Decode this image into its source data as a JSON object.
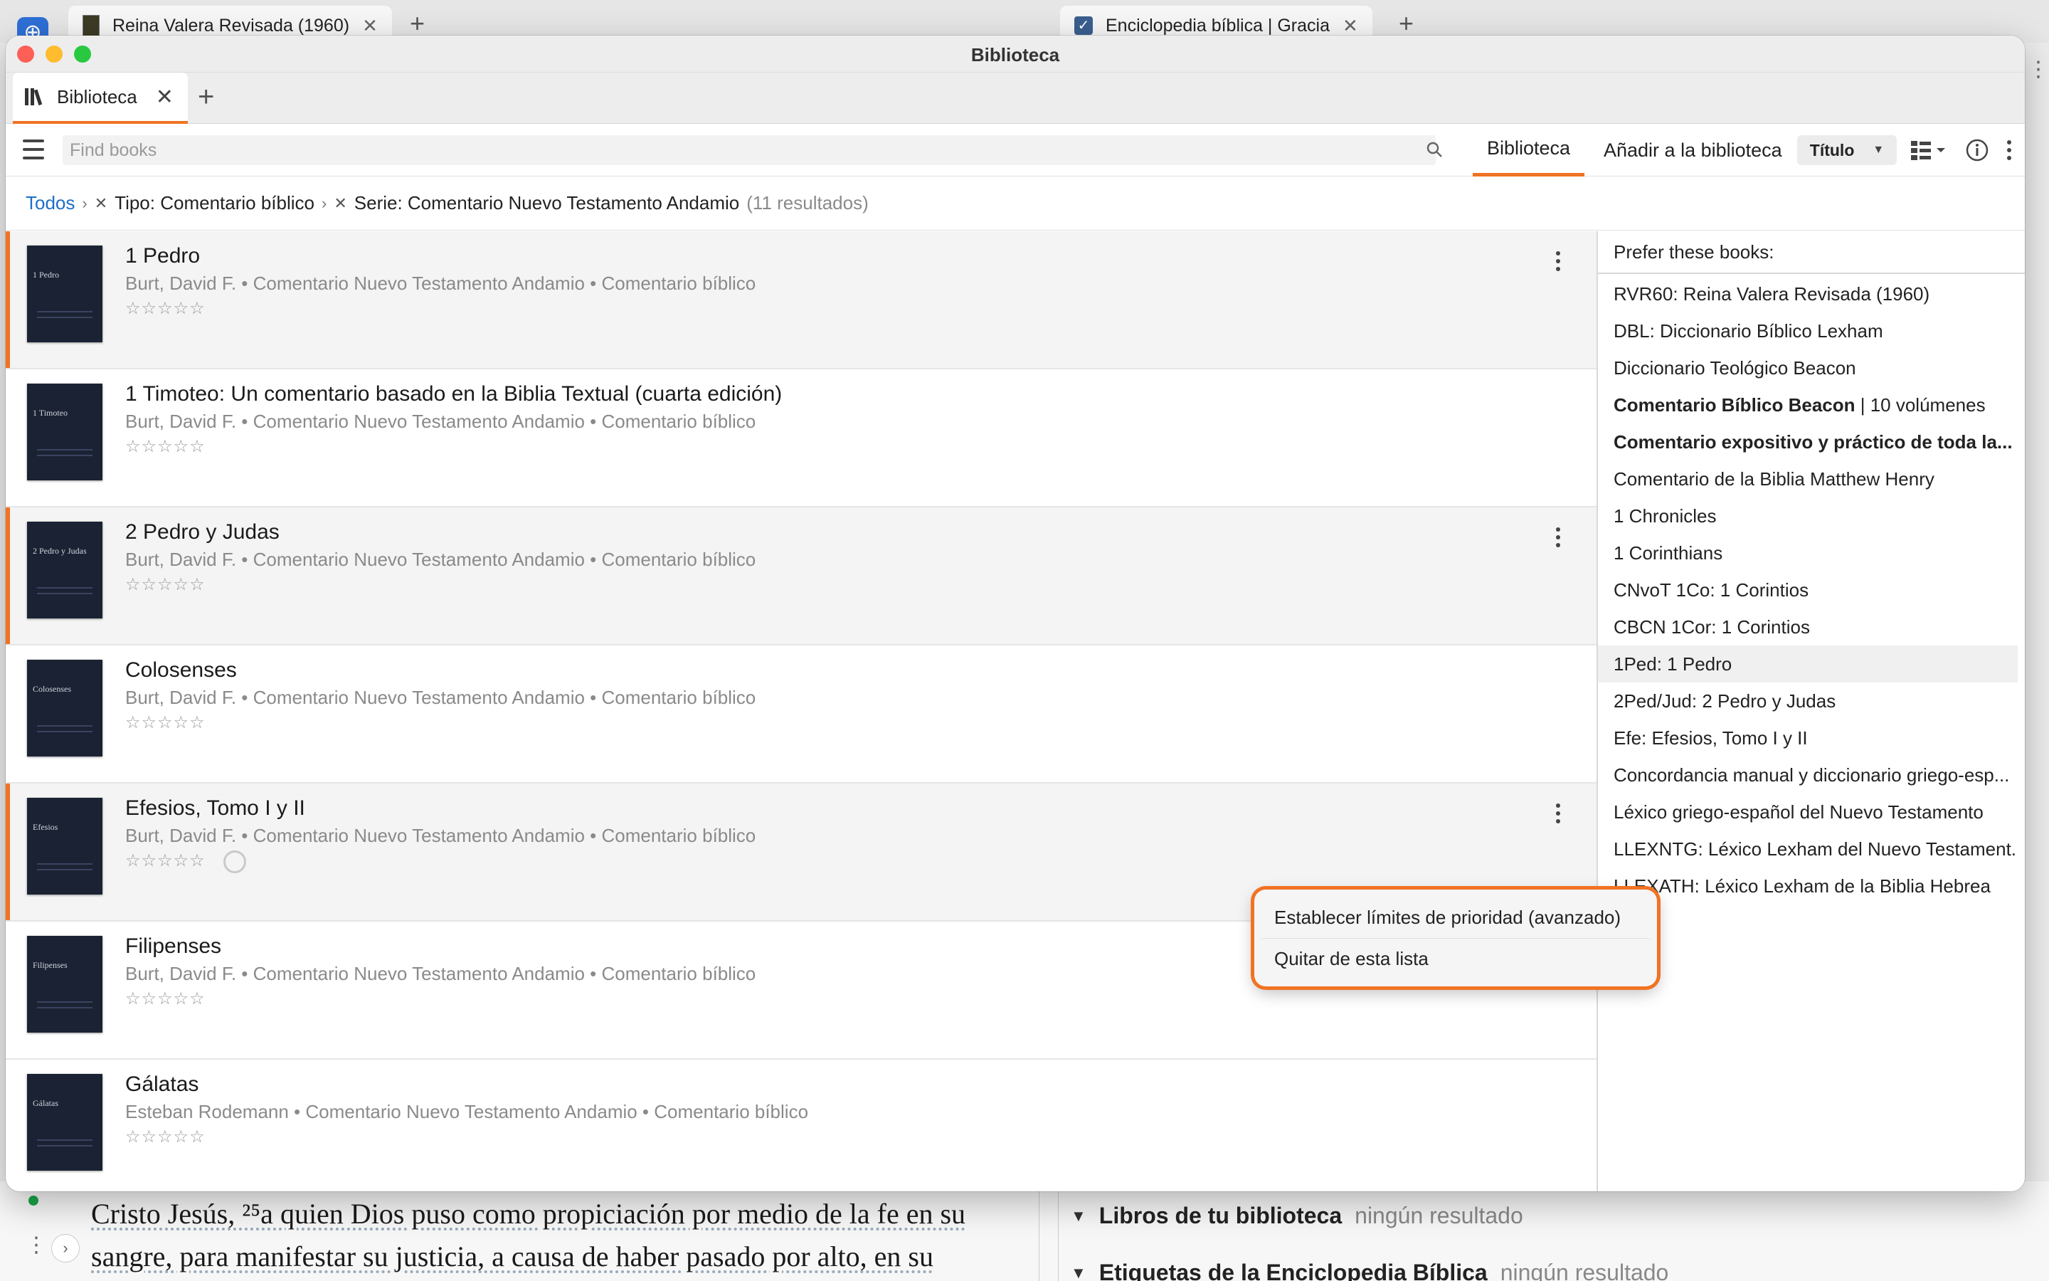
{
  "background": {
    "tabs": [
      {
        "label": "Reina Valera Revisada (1960)"
      },
      {
        "label": "Enciclopedia bíblica | Gracia"
      }
    ],
    "text_line_1": "Cristo Jesús, ²⁵a quien Dios puso como propiciación por medio de la fe en su",
    "text_line_2": "sangre, para manifestar su justicia, a causa de haber pasado por alto, en su",
    "right_section_1": {
      "title": "Libros de tu biblioteca",
      "status": "ningún resultado"
    },
    "right_section_2": {
      "title": "Etiquetas de la Enciclopedia Bíblica",
      "status": "ningún resultado"
    }
  },
  "window": {
    "title": "Biblioteca",
    "tab": {
      "label": "Biblioteca"
    },
    "search_placeholder": "Find books",
    "toolbar": {
      "tab_library": "Biblioteca",
      "tab_add": "Añadir a la biblioteca",
      "sort_label": "Título"
    },
    "breadcrumbs": {
      "root": "Todos",
      "filter_type": "Tipo: Comentario bíblico",
      "filter_series": "Serie: Comentario Nuevo Testamento Andamio",
      "count": "(11 resultados)"
    }
  },
  "books": [
    {
      "title": "1 Pedro",
      "meta": "Burt, David F. • Comentario Nuevo Testamento Andamio • Comentario bíblico",
      "stars": "☆☆☆☆☆",
      "cover_title": "1 Pedro"
    },
    {
      "title": "1 Timoteo: Un comentario basado en la Biblia Textual (cuarta edición)",
      "meta": "Burt, David F. • Comentario Nuevo Testamento Andamio • Comentario bíblico",
      "stars": "☆☆☆☆☆",
      "cover_title": "1 Timoteo"
    },
    {
      "title": "2 Pedro y Judas",
      "meta": "Burt, David F. • Comentario Nuevo Testamento Andamio • Comentario bíblico",
      "stars": "☆☆☆☆☆",
      "cover_title": "2 Pedro y Judas"
    },
    {
      "title": "Colosenses",
      "meta": "Burt, David F. • Comentario Nuevo Testamento Andamio • Comentario bíblico",
      "stars": "☆☆☆☆☆",
      "cover_title": "Colosenses"
    },
    {
      "title": "Efesios, Tomo I y II",
      "meta": "Burt, David F. • Comentario Nuevo Testamento Andamio • Comentario bíblico",
      "stars": "☆☆☆☆☆",
      "cover_title": "Efesios"
    },
    {
      "title": "Filipenses",
      "meta": "Burt, David F. • Comentario Nuevo Testamento Andamio • Comentario bíblico",
      "stars": "☆☆☆☆☆",
      "cover_title": "Filipenses"
    },
    {
      "title": "Gálatas",
      "meta": "Esteban Rodemann • Comentario Nuevo Testamento Andamio • Comentario bíblico",
      "stars": "☆☆☆☆☆",
      "cover_title": "Gálatas"
    }
  ],
  "prefer_panel": {
    "header": "Prefer these books:",
    "items": [
      {
        "label": "RVR60: Reina Valera Revisada (1960)"
      },
      {
        "label": "DBL: Diccionario Bíblico Lexham"
      },
      {
        "label": "Diccionario Teológico Beacon"
      },
      {
        "label_bold": "Comentario Bíblico Beacon",
        "label_rest": " | 10 volúmenes"
      },
      {
        "label_bold": "Comentario expositivo y práctico de toda la..."
      },
      {
        "label": "Comentario de la Biblia Matthew Henry"
      },
      {
        "label": "1 Chronicles"
      },
      {
        "label": "1 Corinthians"
      },
      {
        "label": "CNvoT 1Co: 1 Corintios"
      },
      {
        "label": "CBCN 1Cor: 1 Corintios"
      },
      {
        "label": "1Ped: 1 Pedro"
      },
      {
        "label": "2Ped/Jud: 2 Pedro y Judas"
      },
      {
        "label": "Efe: Efesios, Tomo I y II"
      },
      {
        "label": "Concordancia manual y diccionario griego-esp..."
      },
      {
        "label": "Léxico griego-español del Nuevo Testamento"
      },
      {
        "label": "LLEXNTG: Léxico Lexham del Nuevo Testament..."
      },
      {
        "label": "LLEXATH: Léxico Lexham de la Biblia Hebrea"
      }
    ]
  },
  "context_menu": {
    "items": [
      {
        "label": "Establecer límites de prioridad (avanzado)"
      },
      {
        "label": "Quitar de esta lista"
      }
    ]
  },
  "colors": {
    "accent": "#f07323",
    "link": "#1d6fc9"
  }
}
